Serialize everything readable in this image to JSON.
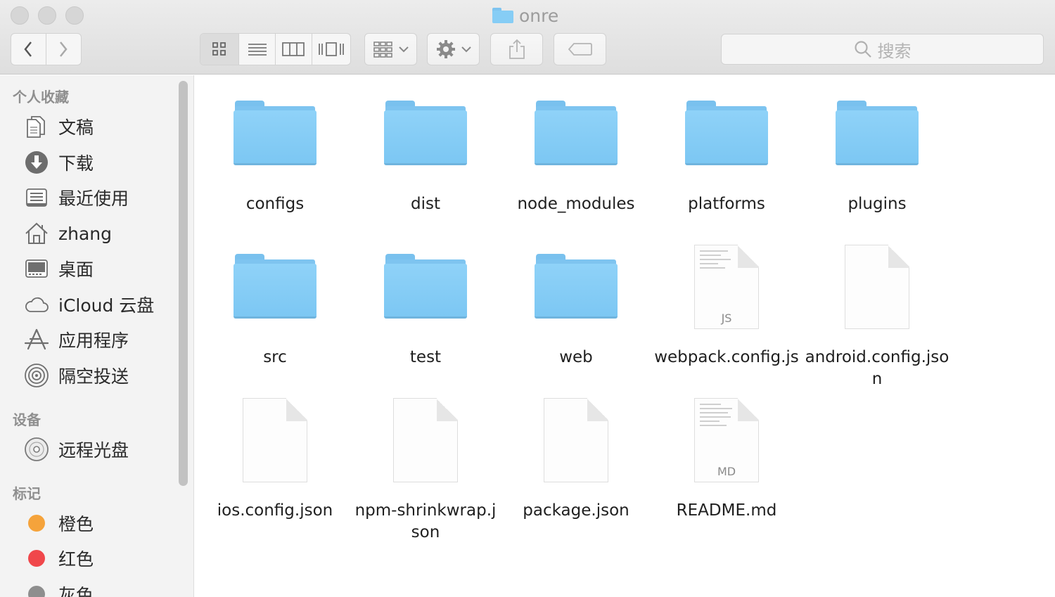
{
  "window": {
    "title": "onre",
    "search_placeholder": "搜索"
  },
  "toolbar": {
    "back_icon": "chevron-left-icon",
    "forward_icon": "chevron-right-icon",
    "view_modes": [
      "icon-view",
      "list-view",
      "column-view",
      "cover-flow-view"
    ],
    "active_view": "icon-view",
    "arrange_icon": "arrange-grid-icon",
    "action_icon": "gear-icon",
    "share_icon": "share-icon",
    "tag_icon": "tag-icon"
  },
  "sidebar": {
    "favorites_heading": "个人收藏",
    "favorites": [
      {
        "label": "文稿",
        "icon": "documents-icon"
      },
      {
        "label": "下载",
        "icon": "download-icon"
      },
      {
        "label": "最近使用",
        "icon": "recents-icon"
      },
      {
        "label": "zhang",
        "icon": "home-icon"
      },
      {
        "label": "桌面",
        "icon": "desktop-icon"
      },
      {
        "label": "iCloud 云盘",
        "icon": "cloud-icon"
      },
      {
        "label": "应用程序",
        "icon": "applications-icon"
      },
      {
        "label": "隔空投送",
        "icon": "airdrop-icon"
      }
    ],
    "devices_heading": "设备",
    "devices": [
      {
        "label": "远程光盘",
        "icon": "disc-icon"
      }
    ],
    "tags_heading": "标记",
    "tags": [
      {
        "label": "橙色",
        "color": "#f5a33b"
      },
      {
        "label": "红色",
        "color": "#f0474b"
      },
      {
        "label": "灰色",
        "color": "#8e8e8e"
      }
    ]
  },
  "files": [
    {
      "name": "configs",
      "kind": "folder"
    },
    {
      "name": "dist",
      "kind": "folder"
    },
    {
      "name": "node_modules",
      "kind": "folder"
    },
    {
      "name": "platforms",
      "kind": "folder"
    },
    {
      "name": "plugins",
      "kind": "folder"
    },
    {
      "name": "src",
      "kind": "folder"
    },
    {
      "name": "test",
      "kind": "folder"
    },
    {
      "name": "web",
      "kind": "folder"
    },
    {
      "name": "webpack.config.js",
      "kind": "document",
      "ext": "JS"
    },
    {
      "name": "android.config.json",
      "kind": "document",
      "ext": ""
    },
    {
      "name": "ios.config.json",
      "kind": "document",
      "ext": ""
    },
    {
      "name": "npm-shrinkwrap.json",
      "kind": "document",
      "ext": ""
    },
    {
      "name": "package.json",
      "kind": "document",
      "ext": ""
    },
    {
      "name": "README.md",
      "kind": "document",
      "ext": "MD"
    }
  ]
}
